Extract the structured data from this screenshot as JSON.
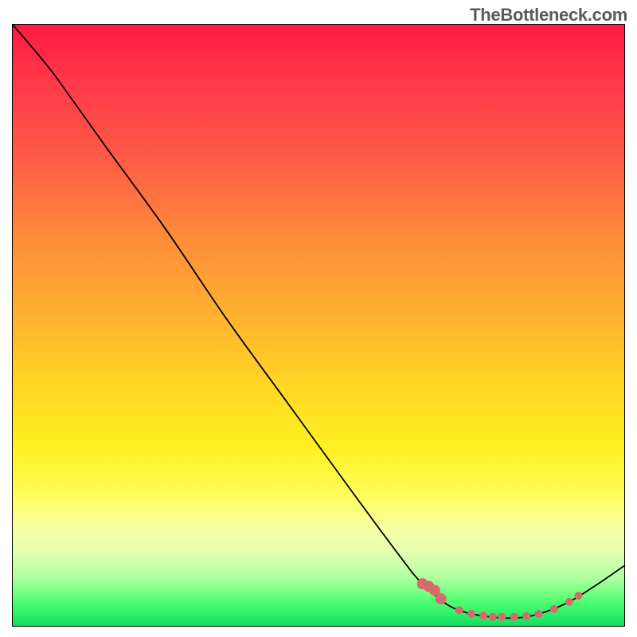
{
  "watermark": "TheBottleneck.com",
  "chart_data": {
    "type": "line",
    "title": "",
    "xlabel": "",
    "ylabel": "",
    "xlim": [
      0,
      100
    ],
    "ylim": [
      0,
      100
    ],
    "grid": false,
    "series": [
      {
        "name": "curve",
        "points": [
          {
            "x": 0,
            "y": 100
          },
          {
            "x": 5,
            "y": 94
          },
          {
            "x": 8,
            "y": 90
          },
          {
            "x": 15,
            "y": 80
          },
          {
            "x": 25,
            "y": 66
          },
          {
            "x": 35,
            "y": 51
          },
          {
            "x": 45,
            "y": 37
          },
          {
            "x": 55,
            "y": 23
          },
          {
            "x": 63,
            "y": 12
          },
          {
            "x": 67,
            "y": 7
          },
          {
            "x": 72,
            "y": 3
          },
          {
            "x": 78,
            "y": 1.5
          },
          {
            "x": 84,
            "y": 1.5
          },
          {
            "x": 90,
            "y": 3.5
          },
          {
            "x": 95,
            "y": 6.5
          },
          {
            "x": 100,
            "y": 10
          }
        ]
      }
    ],
    "markers": [
      {
        "x": 67,
        "y": 7
      },
      {
        "x": 68,
        "y": 6.6
      },
      {
        "x": 69,
        "y": 5.9
      },
      {
        "x": 70,
        "y": 4.5
      },
      {
        "x": 73,
        "y": 2.6
      },
      {
        "x": 75,
        "y": 2.0
      },
      {
        "x": 77,
        "y": 1.7
      },
      {
        "x": 78.5,
        "y": 1.5
      },
      {
        "x": 80,
        "y": 1.5
      },
      {
        "x": 82,
        "y": 1.5
      },
      {
        "x": 84,
        "y": 1.6
      },
      {
        "x": 86,
        "y": 2.0
      },
      {
        "x": 88.5,
        "y": 2.8
      },
      {
        "x": 91,
        "y": 4.0
      },
      {
        "x": 92.5,
        "y": 5.0
      }
    ],
    "marker_radius_large": 7,
    "marker_radius_small": 5
  }
}
